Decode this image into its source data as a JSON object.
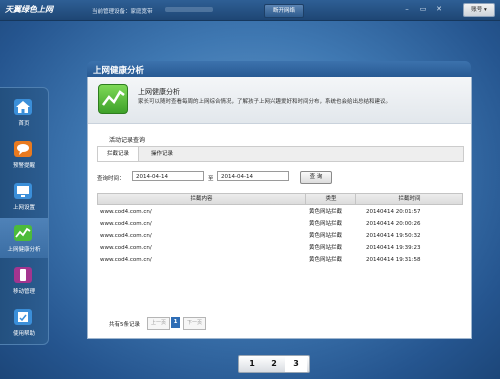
{
  "topbar": {
    "logo_text": "天翼绿色上网",
    "device_label": "当前管理设备：家庭宽带",
    "disconnect_label": "断开网络",
    "account_label": "账号",
    "minimize_icon": "minimize-icon",
    "restore_icon": "restore-icon",
    "close_icon": "close-icon"
  },
  "sidebar": {
    "items": [
      {
        "label": "首页",
        "icon": "home-icon",
        "color": "#3b8fd9"
      },
      {
        "label": "预警提醒",
        "icon": "chat-bubble-icon",
        "color": "#e97a1f"
      },
      {
        "label": "上网设置",
        "icon": "monitor-settings-icon",
        "color": "#3b8fd9"
      },
      {
        "label": "上网健康分析",
        "icon": "health-chart-icon",
        "color": "#4cbb3a",
        "active": true
      },
      {
        "label": "移动管理",
        "icon": "mobile-icon",
        "color": "#a3358f"
      },
      {
        "label": "使用帮助",
        "icon": "help-book-icon",
        "color": "#3b8fd9"
      }
    ]
  },
  "panel": {
    "title": "上网健康分析",
    "intro_title": "上网健康分析",
    "intro_desc": "家长可以随时查看每周的上网综合情况，了解孩子上网兴趣爱好和时间分布，系统也会给出总结和建议。",
    "section_title": "活动记录查询",
    "tabs": [
      {
        "label": "拦截记录",
        "active": true
      },
      {
        "label": "操作记录",
        "active": false
      }
    ],
    "query": {
      "label": "查询时间：",
      "start_date": "2014-04-14",
      "to_label": "至",
      "end_date": "2014-04-14",
      "button_label": "查  询"
    },
    "table": {
      "headers": [
        "拦截内容",
        "类型",
        "拦截时间"
      ],
      "rows": [
        [
          "www.cod4.com.cn/",
          "黄色网站拦截",
          "20140414 20:01:57"
        ],
        [
          "www.cod4.com.cn/",
          "黄色网站拦截",
          "20140414 20:00:26"
        ],
        [
          "www.cod4.com.cn/",
          "黄色网站拦截",
          "20140414 19:50:32"
        ],
        [
          "www.cod4.com.cn/",
          "黄色网站拦截",
          "20140414 19:39:23"
        ],
        [
          "www.cod4.com.cn/",
          "黄色网站拦截",
          "20140414 19:31:58"
        ]
      ]
    },
    "pager": {
      "info": "共有5条记录",
      "prev_label": "上一页",
      "current_page": "1",
      "next_label": "下一页"
    }
  },
  "bottom_pager": {
    "pages": [
      "1",
      "2",
      "3"
    ],
    "active": "3"
  }
}
